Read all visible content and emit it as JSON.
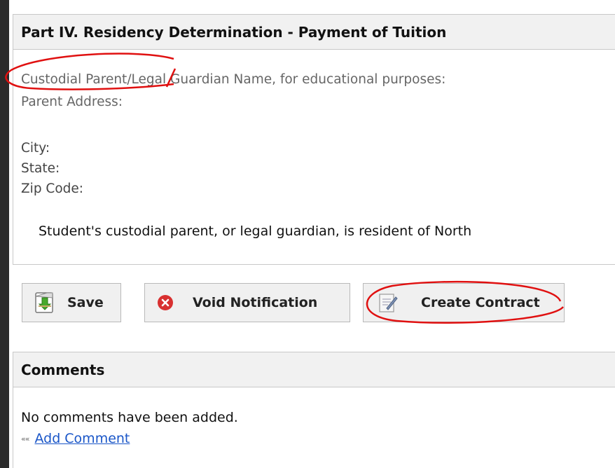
{
  "residency_section": {
    "title": "Part IV. Residency Determination - Payment of Tuition",
    "guardian_label": "Custodial Parent/Legal Guardian Name, for educational purposes:",
    "address_label": "Parent Address:",
    "city_label": "City:",
    "state_label": "State:",
    "zip_label": "Zip Code:",
    "statement": "Student's custodial parent, or legal guardian, is resident of North"
  },
  "actions": {
    "save_label": "Save",
    "void_label": "Void Notification",
    "contract_label": "Create Contract"
  },
  "comments_section": {
    "title": "Comments",
    "empty_text": "No comments have been added.",
    "add_link": "Add Comment",
    "chevron": "««"
  },
  "icons": {
    "save": "save-document-icon",
    "void": "red-x-circle-icon",
    "contract": "contract-pen-icon"
  },
  "colors": {
    "annotation": "#e01010",
    "link": "#1a56c8",
    "void_icon": "#d83030"
  }
}
